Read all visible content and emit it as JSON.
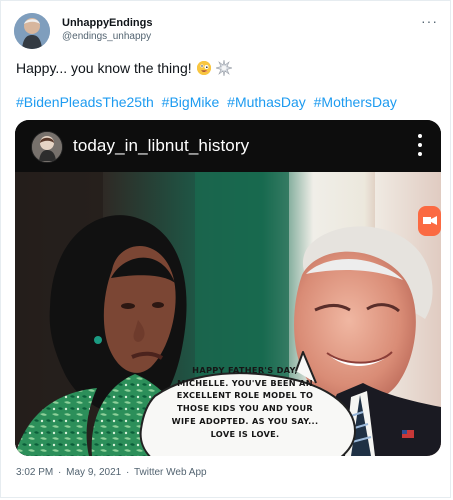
{
  "tweet": {
    "author": {
      "display_name": "UnhappyEndings",
      "handle": "@endings_unhappy",
      "avatar_icon": "profile-photo"
    },
    "more_icon": "more-horizontal-icon",
    "more_label": "···",
    "text": "Happy... you know the thing!",
    "emojis": [
      "zany-face-emoji",
      "dizzy-burst-emoji"
    ],
    "hashtags": [
      "#BidenPleadsThe25th",
      "#BigMike",
      "#MuthasDay",
      "#MothersDay"
    ],
    "media": {
      "header_title": "today_in_libnut_history",
      "speech_bubble": "Happy Father's Day, Michelle. You've been an excellent role model to those kids you and your wife adopted. As you say... love is love.",
      "more_icon": "vertical-more-icon"
    },
    "meta": {
      "time": "3:02 PM",
      "date": "May 9, 2021",
      "source": "Twitter Web App",
      "separator": "·"
    }
  },
  "colors": {
    "link": "#1d9bf0",
    "secondary_text": "#536471",
    "border": "#e6ecf0"
  }
}
